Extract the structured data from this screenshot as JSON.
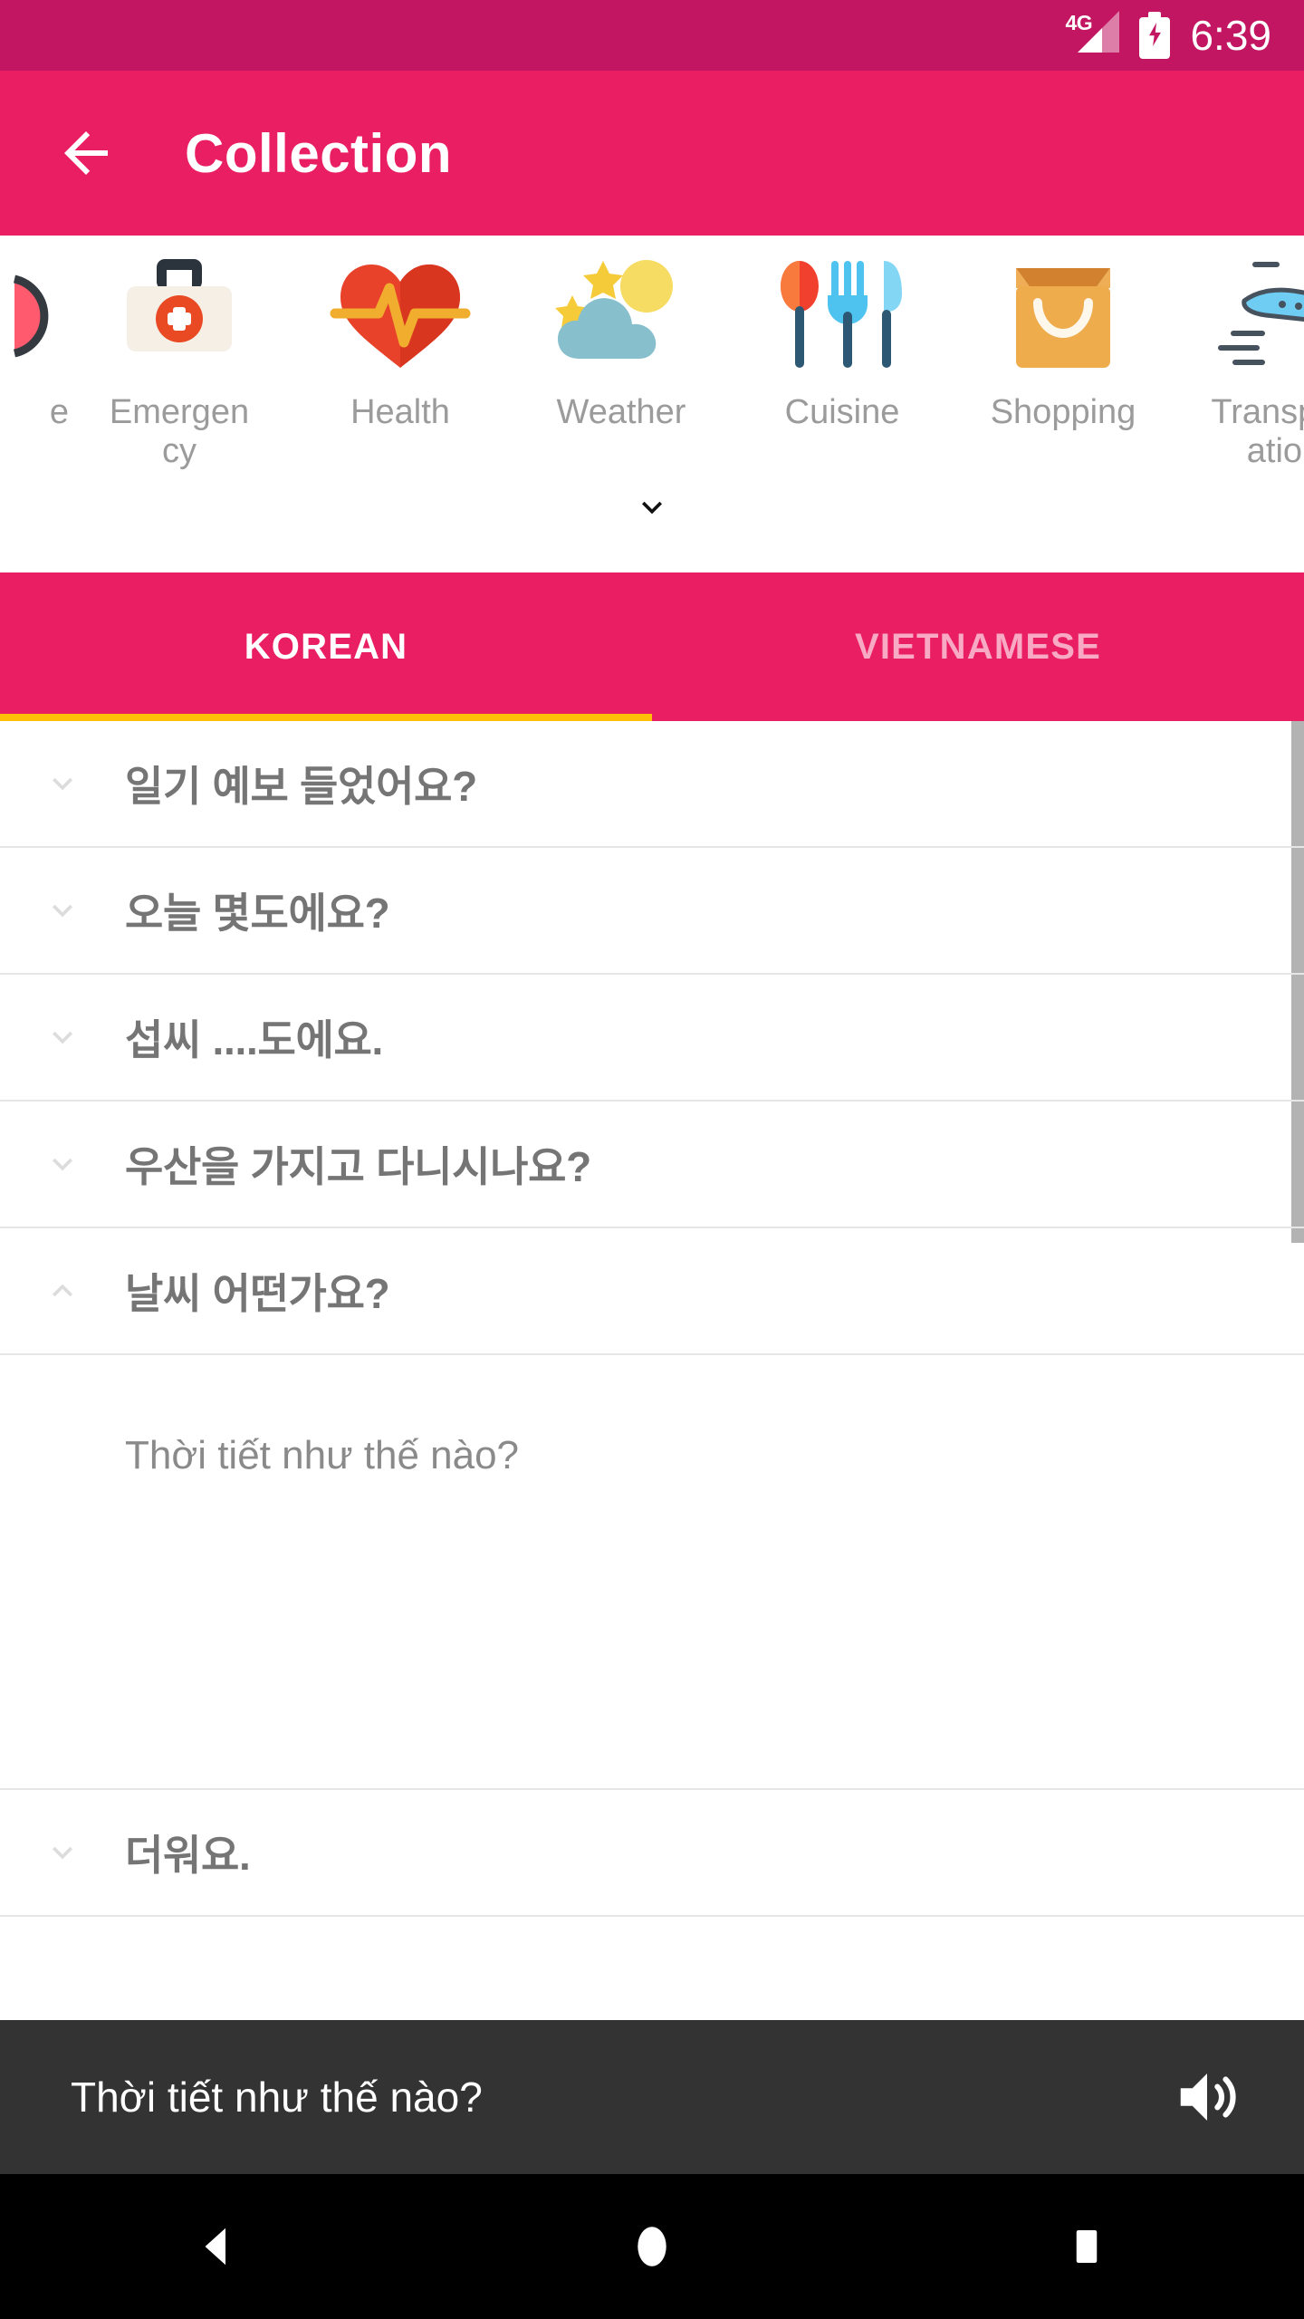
{
  "statusbar": {
    "network_label": "4G",
    "time": "6:39",
    "battery_icon": "battery-charging-icon",
    "signal_icon": "signal-bars-icon"
  },
  "appbar": {
    "back_icon": "arrow-back-icon",
    "title": "Collection",
    "bg_color": "#e91e63"
  },
  "categories": {
    "expand_icon": "chevron-down-icon",
    "items": [
      {
        "label": "e",
        "icon": "partial-icon",
        "partial": true
      },
      {
        "label": "Emergency",
        "icon": "first-aid-kit-icon",
        "partial": false
      },
      {
        "label": "Health",
        "icon": "heart-pulse-icon",
        "partial": false
      },
      {
        "label": "Weather",
        "icon": "sun-cloud-icon",
        "partial": false
      },
      {
        "label": "Cuisine",
        "icon": "cutlery-icon",
        "partial": false
      },
      {
        "label": "Shopping",
        "icon": "shopping-bag-icon",
        "partial": false
      },
      {
        "label": "Transportation",
        "icon": "airplane-icon",
        "partial": false
      }
    ]
  },
  "tabs": {
    "items": [
      {
        "label": "KOREAN",
        "active": true
      },
      {
        "label": "VIETNAMESE",
        "active": false
      }
    ],
    "indicator_color": "#ffc107"
  },
  "phrases": {
    "rows": [
      {
        "text": "일기 예보 들었어요?",
        "chevron": "chevron-down-icon",
        "expanded": false
      },
      {
        "text": "오늘 몇도에요?",
        "chevron": "chevron-down-icon",
        "expanded": false
      },
      {
        "text": "섭씨 ....도에요.",
        "chevron": "chevron-down-icon",
        "expanded": false
      },
      {
        "text": "우산을 가지고 다니시나요?",
        "chevron": "chevron-down-icon",
        "expanded": false
      },
      {
        "text": "날씨 어떤가요?",
        "chevron": "chevron-up-icon",
        "expanded": true
      },
      {
        "text": "더워요.",
        "chevron": "chevron-down-icon",
        "expanded": false
      }
    ],
    "expanded_answer": "Thời tiết như thế nào?"
  },
  "playbar": {
    "text": "Thời tiết như thế nào?",
    "speaker_icon": "volume-up-icon",
    "bg_color": "#333333"
  },
  "navbar": {
    "back_icon": "nav-back-triangle-icon",
    "home_icon": "nav-home-circle-icon",
    "recents_icon": "nav-recents-square-icon"
  }
}
